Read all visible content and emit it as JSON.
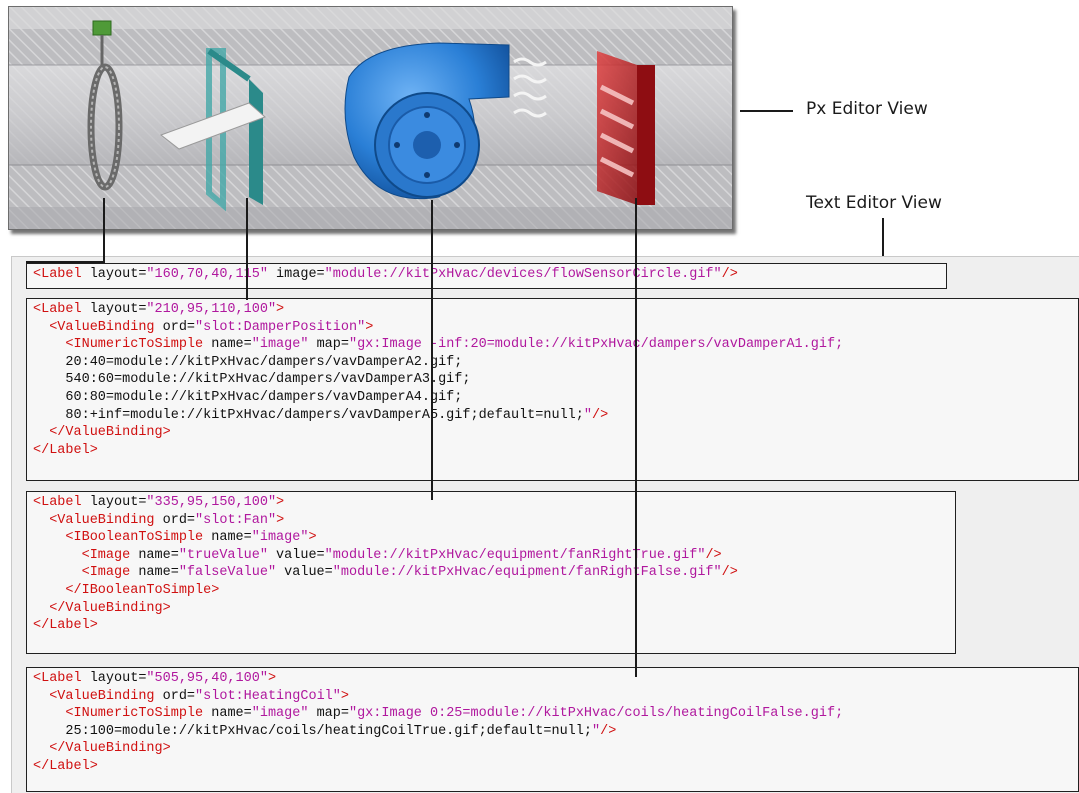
{
  "callouts": {
    "px_editor_view": "Px Editor View",
    "text_editor_view": "Text Editor View"
  },
  "px_editor": {
    "components": [
      {
        "icon": "flow-sensor-icon",
        "color": "#8a8a8a"
      },
      {
        "icon": "damper-icon",
        "color": "#2e8c8c"
      },
      {
        "icon": "fan-icon",
        "color": "#1f6fc9"
      },
      {
        "icon": "heating-coil-icon",
        "color": "#b3141a"
      }
    ]
  },
  "colors": {
    "tag": "#d01010",
    "string": "#b0189e",
    "text": "#111111"
  },
  "code_blocks": [
    {
      "lines": [
        [
          [
            "t",
            "<Label"
          ],
          [
            "k",
            " layout="
          ],
          [
            "s",
            "\"160,70,40,115\""
          ],
          [
            "k",
            " image="
          ],
          [
            "s",
            "\"module://kitPxHvac/devices/flowSensorCircle.gif\""
          ],
          [
            "t",
            "/>"
          ]
        ]
      ]
    },
    {
      "lines": [
        [
          [
            "t",
            "<Label"
          ],
          [
            "k",
            " layout="
          ],
          [
            "s",
            "\"210,95,110,100\""
          ],
          [
            "t",
            ">"
          ]
        ],
        [
          [
            "k",
            "  "
          ],
          [
            "t",
            "<ValueBinding"
          ],
          [
            "k",
            " ord="
          ],
          [
            "s",
            "\"slot:DamperPosition\""
          ],
          [
            "t",
            ">"
          ]
        ],
        [
          [
            "k",
            "    "
          ],
          [
            "t",
            "<INumericToSimple"
          ],
          [
            "k",
            " name="
          ],
          [
            "s",
            "\"image\""
          ],
          [
            "k",
            " map="
          ],
          [
            "s",
            "\"gx:Image -inf:20=module://kitPxHvac/dampers/vavDamperA1.gif;"
          ]
        ],
        [
          [
            "k",
            "    20:40=module://kitPxHvac/dampers/vavDamperA2.gif;"
          ]
        ],
        [
          [
            "k",
            "    540:60=module://kitPxHvac/dampers/vavDamperA3.gif;"
          ]
        ],
        [
          [
            "k",
            "    60:80=module://kitPxHvac/dampers/vavDamperA4.gif;"
          ]
        ],
        [
          [
            "k",
            "    80:+inf=module://kitPxHvac/dampers/vavDamperA5.gif;default=null;"
          ],
          [
            "s",
            "\""
          ],
          [
            "t",
            "/>"
          ]
        ],
        [
          [
            "k",
            "  "
          ],
          [
            "t",
            "</ValueBinding>"
          ]
        ],
        [
          [
            "t",
            "</Label>"
          ]
        ]
      ]
    },
    {
      "lines": [
        [
          [
            "t",
            "<Label"
          ],
          [
            "k",
            " layout="
          ],
          [
            "s",
            "\"335,95,150,100\""
          ],
          [
            "t",
            ">"
          ]
        ],
        [
          [
            "k",
            "  "
          ],
          [
            "t",
            "<ValueBinding"
          ],
          [
            "k",
            " ord="
          ],
          [
            "s",
            "\"slot:Fan\""
          ],
          [
            "t",
            ">"
          ]
        ],
        [
          [
            "k",
            "    "
          ],
          [
            "t",
            "<IBooleanToSimple"
          ],
          [
            "k",
            " name="
          ],
          [
            "s",
            "\"image\""
          ],
          [
            "t",
            ">"
          ]
        ],
        [
          [
            "k",
            "      "
          ],
          [
            "t",
            "<Image"
          ],
          [
            "k",
            " name="
          ],
          [
            "s",
            "\"trueValue\""
          ],
          [
            "k",
            " value="
          ],
          [
            "s",
            "\"module://kitPxHvac/equipment/fanRightTrue.gif\""
          ],
          [
            "t",
            "/>"
          ]
        ],
        [
          [
            "k",
            "      "
          ],
          [
            "t",
            "<Image"
          ],
          [
            "k",
            " name="
          ],
          [
            "s",
            "\"falseValue\""
          ],
          [
            "k",
            " value="
          ],
          [
            "s",
            "\"module://kitPxHvac/equipment/fanRightFalse.gif\""
          ],
          [
            "t",
            "/>"
          ]
        ],
        [
          [
            "k",
            "    "
          ],
          [
            "t",
            "</IBooleanToSimple>"
          ]
        ],
        [
          [
            "k",
            "  "
          ],
          [
            "t",
            "</ValueBinding>"
          ]
        ],
        [
          [
            "t",
            "</Label>"
          ]
        ]
      ]
    },
    {
      "lines": [
        [
          [
            "t",
            "<Label"
          ],
          [
            "k",
            " layout="
          ],
          [
            "s",
            "\"505,95,40,100\""
          ],
          [
            "t",
            ">"
          ]
        ],
        [
          [
            "k",
            "  "
          ],
          [
            "t",
            "<ValueBinding"
          ],
          [
            "k",
            " ord="
          ],
          [
            "s",
            "\"slot:HeatingCoil\""
          ],
          [
            "t",
            ">"
          ]
        ],
        [
          [
            "k",
            "    "
          ],
          [
            "t",
            "<INumericToSimple"
          ],
          [
            "k",
            " name="
          ],
          [
            "s",
            "\"image\""
          ],
          [
            "k",
            " map="
          ],
          [
            "s",
            "\"gx:Image 0:25=module://kitPxHvac/coils/heatingCoilFalse.gif;"
          ]
        ],
        [
          [
            "k",
            "    25:100=module://kitPxHvac/coils/heatingCoilTrue.gif;default=null;"
          ],
          [
            "s",
            "\""
          ],
          [
            "t",
            "/>"
          ]
        ],
        [
          [
            "k",
            "  "
          ],
          [
            "t",
            "</ValueBinding>"
          ]
        ],
        [
          [
            "t",
            "</Label>"
          ]
        ]
      ]
    }
  ]
}
